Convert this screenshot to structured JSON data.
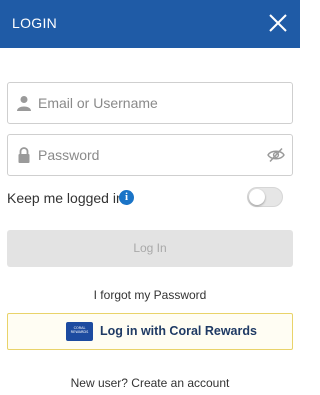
{
  "header": {
    "title": "LOGIN"
  },
  "form": {
    "email_placeholder": "Email or Username",
    "password_placeholder": "Password",
    "keep_logged_in_label": "Keep me logged in",
    "keep_logged_in_enabled": false,
    "login_button_label": "Log In",
    "forgot_password_label": "I forgot my Password",
    "coral_rewards_label": "Log in with Coral Rewards",
    "coral_logo_text": "CORAL REWARDS",
    "signup_label": "New user? Create an account"
  },
  "icons": {
    "close": "close-icon",
    "user": "user-icon",
    "lock": "lock-icon",
    "eye_hidden": "eye-hidden-icon",
    "info": "info-icon"
  },
  "colors": {
    "header_bg": "#1f5ba6",
    "info_blue": "#1a74c7",
    "coral_border": "#e9d36a",
    "coral_brand": "#1d4ba0"
  }
}
